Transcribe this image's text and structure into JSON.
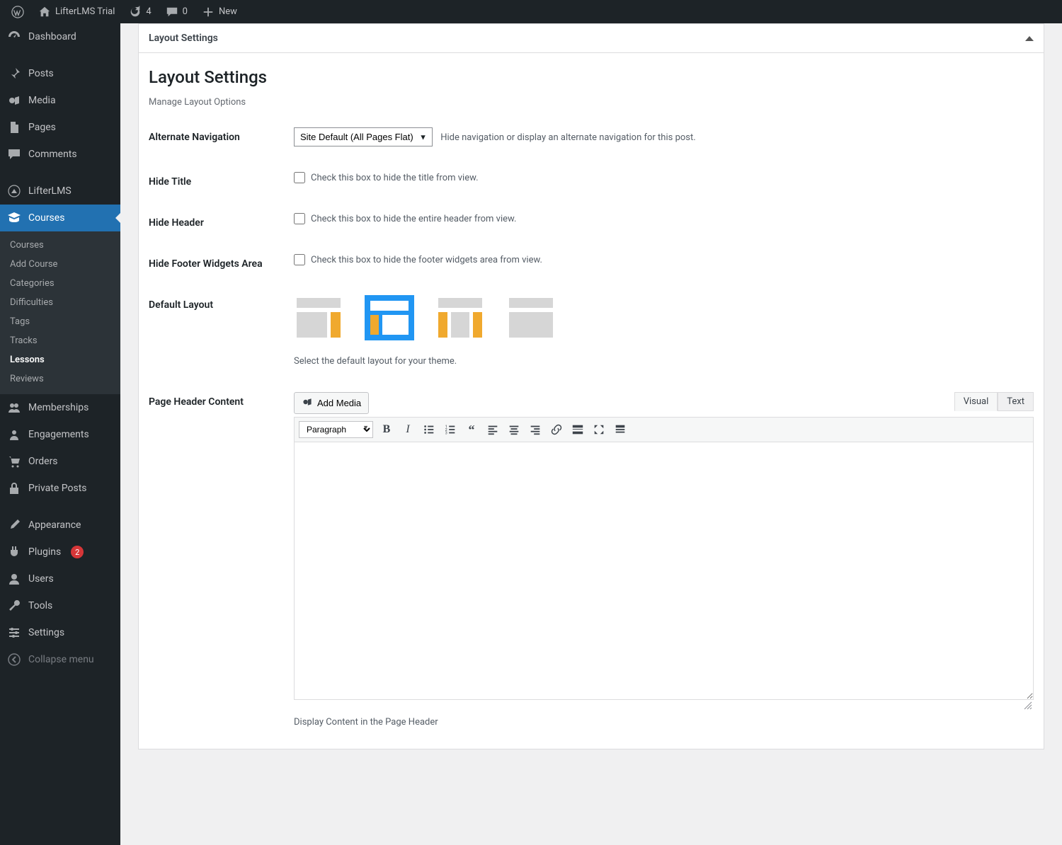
{
  "adminbar": {
    "site_name": "LifterLMS Trial",
    "updates_count": "4",
    "comments_count": "0",
    "new_label": "New"
  },
  "sidemenu": {
    "items": [
      {
        "label": "Dashboard",
        "icon": "dashboard"
      },
      {
        "label": "Posts",
        "icon": "pin"
      },
      {
        "label": "Media",
        "icon": "media"
      },
      {
        "label": "Pages",
        "icon": "pages"
      },
      {
        "label": "Comments",
        "icon": "comments"
      },
      {
        "label": "LifterLMS",
        "icon": "lifter"
      },
      {
        "label": "Courses",
        "icon": "courses",
        "current": true
      },
      {
        "label": "Memberships",
        "icon": "memberships"
      },
      {
        "label": "Engagements",
        "icon": "engagements"
      },
      {
        "label": "Orders",
        "icon": "orders"
      },
      {
        "label": "Private Posts",
        "icon": "private"
      },
      {
        "label": "Appearance",
        "icon": "appearance"
      },
      {
        "label": "Plugins",
        "icon": "plugins",
        "badge": "2"
      },
      {
        "label": "Users",
        "icon": "users"
      },
      {
        "label": "Tools",
        "icon": "tools"
      },
      {
        "label": "Settings",
        "icon": "settings"
      },
      {
        "label": "Collapse menu",
        "icon": "collapse"
      }
    ],
    "courses_sub": [
      {
        "label": "Courses"
      },
      {
        "label": "Add Course"
      },
      {
        "label": "Categories"
      },
      {
        "label": "Difficulties"
      },
      {
        "label": "Tags"
      },
      {
        "label": "Tracks"
      },
      {
        "label": "Lessons",
        "active": true
      },
      {
        "label": "Reviews"
      }
    ]
  },
  "panel": {
    "header": "Layout Settings",
    "title": "Layout Settings",
    "subtitle": "Manage Layout Options",
    "alt_nav": {
      "label": "Alternate Navigation",
      "select_value": "Site Default (All Pages Flat)",
      "hint": "Hide navigation or display an alternate navigation for this post."
    },
    "hide_title": {
      "label": "Hide Title",
      "hint": "Check this box to hide the title from view."
    },
    "hide_header": {
      "label": "Hide Header",
      "hint": "Check this box to hide the entire header from view."
    },
    "hide_footer": {
      "label": "Hide Footer Widgets Area",
      "hint": "Check this box to hide the footer widgets area from view."
    },
    "default_layout": {
      "label": "Default Layout",
      "help": "Select the default layout for your theme."
    },
    "header_content": {
      "label": "Page Header Content",
      "add_media": "Add Media",
      "tab_visual": "Visual",
      "tab_text": "Text",
      "paragraph_label": "Paragraph",
      "footer_hint": "Display Content in the Page Header"
    }
  }
}
